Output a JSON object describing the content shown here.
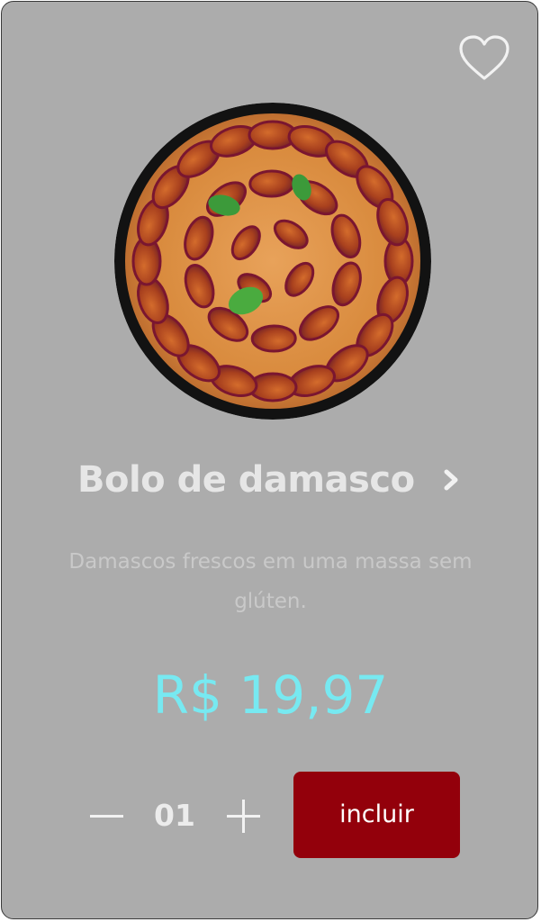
{
  "product": {
    "name": "Bolo de damasco",
    "description": "Damascos frescos em uma massa sem glúten.",
    "price": "R$ 19,97",
    "image": "apricot-cake-photo",
    "favorited": false
  },
  "quantity": {
    "value": "01",
    "decrement_icon": "minus-icon",
    "increment_icon": "plus-icon"
  },
  "actions": {
    "add_label": "incluir",
    "favorite_icon": "heart-outline-icon",
    "details_icon": "chevron-right-icon"
  },
  "colors": {
    "card_background": "#acacac",
    "title": "#e6e6e6",
    "description": "#c9c9c9",
    "price": "#77e9f1",
    "add_button": "#93000b",
    "add_button_text": "#ffffff"
  }
}
